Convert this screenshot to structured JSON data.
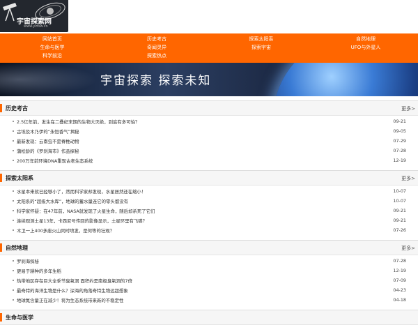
{
  "logo": {
    "name": "宇宙探索网",
    "url": "www.yztsw.cn"
  },
  "nav": {
    "row1": [
      "网站首页",
      "历史考古",
      "探索太阳系",
      "自然地理"
    ],
    "row2": [
      "生命与医学",
      "奇闻灵异",
      "探索宇宙",
      "UFO与外星人"
    ],
    "row3": [
      "科学前沿",
      "探索热点"
    ]
  },
  "banner": {
    "slogan": "宇宙探索  探索未知"
  },
  "sections": [
    {
      "title": "历史考古",
      "more": "更多>",
      "items": [
        {
          "text": "2.5亿年前，发生在二叠纪末期的生物大灭绝，到底有多可怕？",
          "date": "09-21"
        },
        {
          "text": "古埃及木乃伊的“永恒香气”揭秘",
          "date": "09-05"
        },
        {
          "text": "最新发现：云南虫不是脊椎动物",
          "date": "07-29"
        },
        {
          "text": "蒲松龄的《罗刹海市》作品探秘",
          "date": "07-28"
        },
        {
          "text": "200万年前环境DNA重现古老生态系统",
          "date": "12-19"
        }
      ]
    },
    {
      "title": "探索太阳系",
      "more": "更多>",
      "items": [
        {
          "text": "水星本来就已经够小了，然而科学家却发现，水星居然还在缩小！",
          "date": "10-07"
        },
        {
          "text": "太阳系的“超级大水库”，地球的蓄水量连它的零头都没有",
          "date": "10-07"
        },
        {
          "text": "科学家怀疑：在47年前，NASA就发现了火星生命，随后却杀死了它们",
          "date": "09-21"
        },
        {
          "text": "连续观测土星13年，卡西尼号传回的影像显示，土星环里有飞碟？",
          "date": "09-21"
        },
        {
          "text": "木卫一上400多座火山同时喷发，是何等的壮观？",
          "date": "07-26"
        }
      ]
    },
    {
      "title": "自然地理",
      "more": "更多>",
      "items": [
        {
          "text": "罗刹海探秘",
          "date": "07-28"
        },
        {
          "text": "更易于耕种的多年生稻",
          "date": "12-19"
        },
        {
          "text": "热带地区存在巨大全季节臭氧洞 面积约是南极臭氧洞的7倍",
          "date": "07-09"
        },
        {
          "text": "最奇特的海洋生物是什么？深海的角落奇特生物远超想象",
          "date": "04-23"
        },
        {
          "text": "地球氮含量正在减少！将为生态系统带来新的不稳定性",
          "date": "04-18"
        }
      ]
    },
    {
      "title": "生命与医学",
      "more": "更多>",
      "items": []
    }
  ],
  "colors": {
    "accent": "#ff6600",
    "nav_text": "#ffffff"
  }
}
